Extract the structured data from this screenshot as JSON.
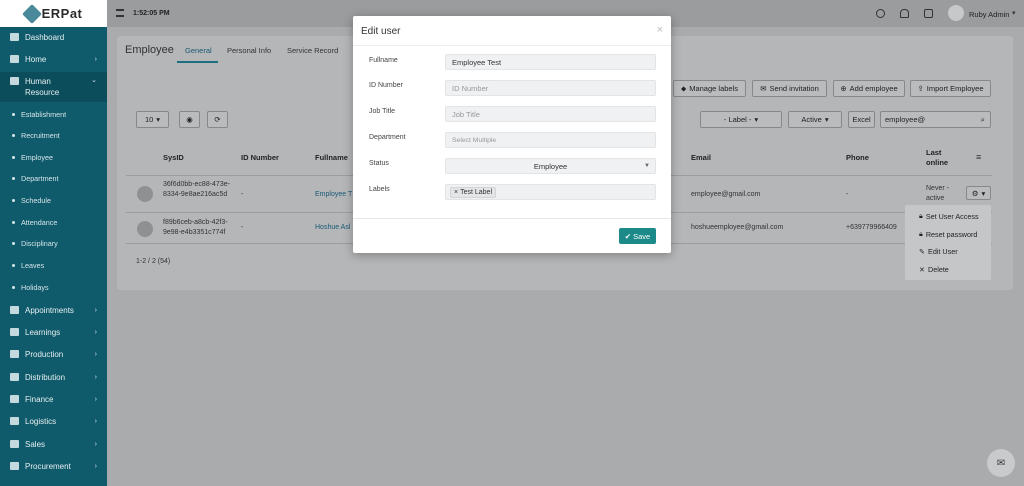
{
  "app": {
    "logo_text": "ERPat",
    "time": "1:52:05 PM",
    "user_name": "Ruby Admin"
  },
  "sidebar": {
    "items": [
      {
        "label": "Dashboard",
        "icon": "dashboard-icon"
      },
      {
        "label": "Home",
        "icon": "home-icon"
      },
      {
        "label": "Human Resource",
        "icon": "briefcase-icon"
      },
      {
        "label": "Appointments",
        "icon": "edit-icon"
      },
      {
        "label": "Learnings",
        "icon": "pencil-icon"
      },
      {
        "label": "Production",
        "icon": "person-icon"
      },
      {
        "label": "Distribution",
        "icon": "bank-icon"
      },
      {
        "label": "Finance",
        "icon": "money-icon"
      },
      {
        "label": "Logistics",
        "icon": "truck-icon"
      },
      {
        "label": "Sales",
        "icon": "cart-icon"
      },
      {
        "label": "Procurement",
        "icon": "building-icon"
      }
    ],
    "subitems": [
      "Establishment",
      "Recruitment",
      "Employee",
      "Department",
      "Schedule",
      "Attendance",
      "Disciplinary",
      "Leaves",
      "Holidays"
    ]
  },
  "page": {
    "title": "Employee",
    "tabs": [
      "General",
      "Personal Info",
      "Service Record"
    ],
    "buttons": {
      "manage_labels": "Manage labels",
      "send_invitation": "Send invitation",
      "add_employee": "Add employee",
      "import_employee": "Import Employee"
    },
    "filters": {
      "page_size": "10",
      "label": "- Label -",
      "active": "Active",
      "excel": "Excel",
      "search": "employee@"
    },
    "table": {
      "headers": [
        "SysID",
        "ID Number",
        "Fullname",
        "Email",
        "Phone",
        "Last online"
      ],
      "rows": [
        {
          "sysid": "36f6d0bb-ec88-473e-8334-9e8ae216ac5d",
          "id": "-",
          "name": "Employee T",
          "email": "employee@gmail.com",
          "phone": "-",
          "last": "Never - active"
        },
        {
          "sysid": "f89b6ceb-a8cb-42f3-9e98-e4b3351c774f",
          "id": "-",
          "name": "Hoshue Asl",
          "email": "hoshueemployee@gmail.com",
          "phone": "+639779966409",
          "last": ""
        }
      ],
      "pagination": "1-2 / 2 (54)"
    }
  },
  "modal": {
    "title": "Edit user",
    "fields": [
      {
        "label": "Fullname",
        "value": "Employee Test"
      },
      {
        "label": "ID Number",
        "placeholder": "ID Number"
      },
      {
        "label": "Job Title",
        "placeholder": "Job Title"
      },
      {
        "label": "Department",
        "placeholder": "Select Multiple"
      },
      {
        "label": "Status",
        "value": "Employee"
      },
      {
        "label": "Labels",
        "value": "Test Label"
      }
    ],
    "save_label": "Save"
  },
  "row_menu": {
    "items": [
      "Set User Access",
      "Reset password",
      "Edit User",
      "Delete"
    ]
  },
  "colors": {
    "sidebar": "#0f5a6b",
    "accent": "#1d8a8a"
  }
}
